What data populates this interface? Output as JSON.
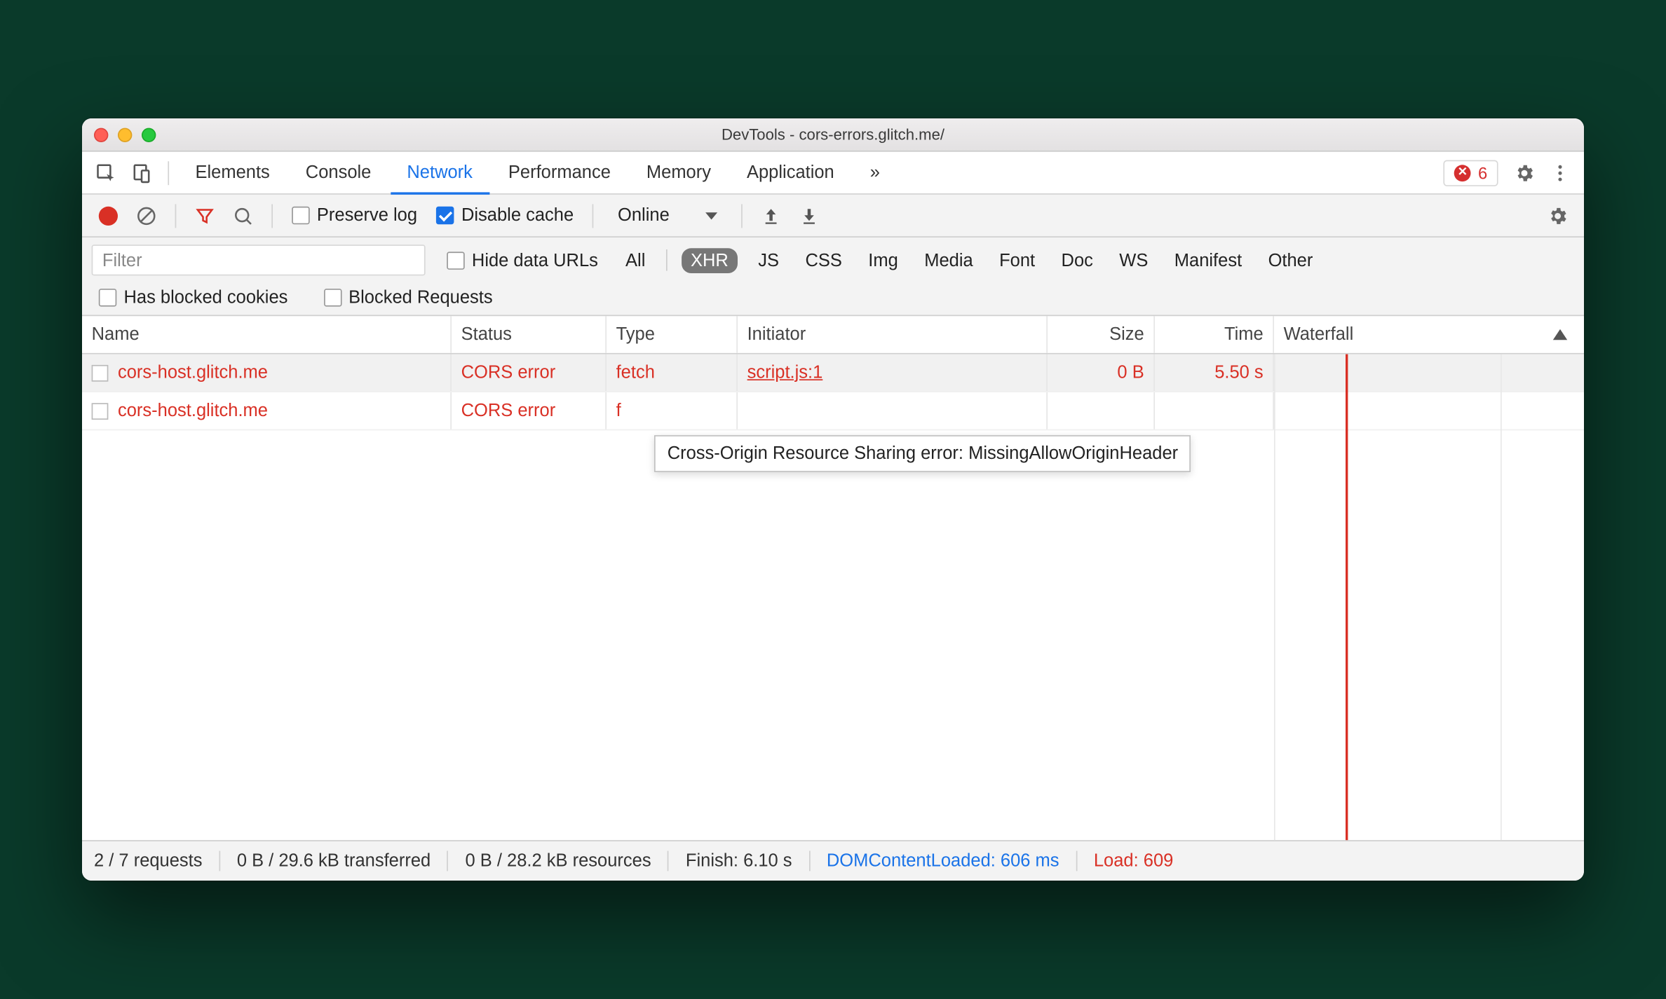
{
  "window": {
    "title": "DevTools - cors-errors.glitch.me/"
  },
  "tabs": {
    "items": [
      "Elements",
      "Console",
      "Network",
      "Performance",
      "Memory",
      "Application"
    ],
    "active": "Network",
    "overflow": "»",
    "error_count": "6"
  },
  "toolbar": {
    "preserve_log": "Preserve log",
    "disable_cache": "Disable cache",
    "throttling": "Online"
  },
  "filterbar": {
    "placeholder": "Filter",
    "hide_data_urls": "Hide data URLs",
    "types": [
      "All",
      "XHR",
      "JS",
      "CSS",
      "Img",
      "Media",
      "Font",
      "Doc",
      "WS",
      "Manifest",
      "Other"
    ],
    "active_type": "XHR",
    "has_blocked_cookies": "Has blocked cookies",
    "blocked_requests": "Blocked Requests"
  },
  "table": {
    "headers": {
      "name": "Name",
      "status": "Status",
      "type": "Type",
      "initiator": "Initiator",
      "size": "Size",
      "time": "Time",
      "waterfall": "Waterfall"
    },
    "rows": [
      {
        "name": "cors-host.glitch.me",
        "status": "CORS error",
        "type": "fetch",
        "initiator": "script.js:1",
        "size": "0 B",
        "time": "5.50 s"
      },
      {
        "name": "cors-host.glitch.me",
        "status": "CORS error",
        "type": "f",
        "initiator": "",
        "size": "",
        "time": ""
      }
    ],
    "tooltip": "Cross-Origin Resource Sharing error: MissingAllowOriginHeader"
  },
  "statusbar": {
    "requests": "2 / 7 requests",
    "transferred": "0 B / 29.6 kB transferred",
    "resources": "0 B / 28.2 kB resources",
    "finish": "Finish: 6.10 s",
    "dcl": "DOMContentLoaded: 606 ms",
    "load": "Load: 609"
  }
}
